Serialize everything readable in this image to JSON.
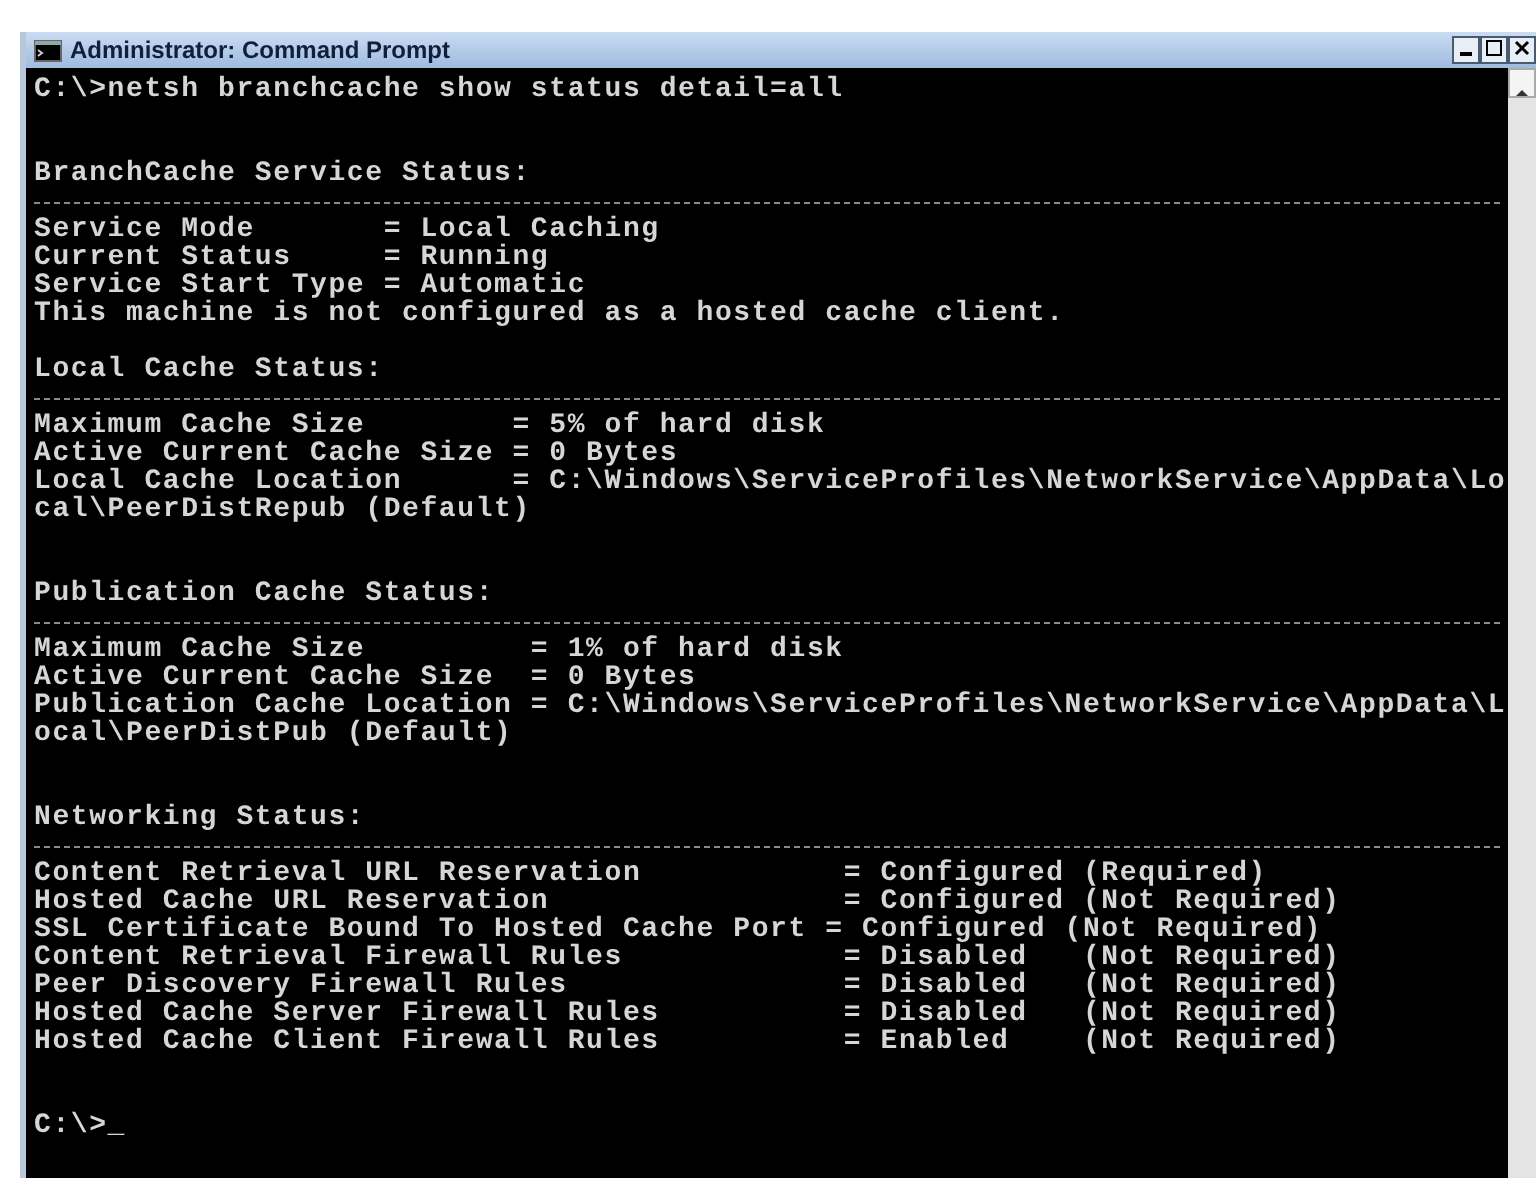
{
  "window": {
    "title": "Administrator: Command Prompt"
  },
  "console": [
    {
      "kind": "line",
      "text": "C:\\>netsh branchcache show status detail=all"
    },
    {
      "kind": "blank"
    },
    {
      "kind": "blank"
    },
    {
      "kind": "line",
      "text": "BranchCache Service Status:"
    },
    {
      "kind": "rule"
    },
    {
      "kind": "line",
      "text": "Service Mode       = Local Caching"
    },
    {
      "kind": "line",
      "text": "Current Status     = Running"
    },
    {
      "kind": "line",
      "text": "Service Start Type = Automatic"
    },
    {
      "kind": "line",
      "text": "This machine is not configured as a hosted cache client."
    },
    {
      "kind": "blank"
    },
    {
      "kind": "line",
      "text": "Local Cache Status:"
    },
    {
      "kind": "rule"
    },
    {
      "kind": "line",
      "text": "Maximum Cache Size        = 5% of hard disk"
    },
    {
      "kind": "line",
      "text": "Active Current Cache Size = 0 Bytes"
    },
    {
      "kind": "line",
      "text": "Local Cache Location      = C:\\Windows\\ServiceProfiles\\NetworkService\\AppData\\Lo"
    },
    {
      "kind": "line",
      "text": "cal\\PeerDistRepub (Default)"
    },
    {
      "kind": "blank"
    },
    {
      "kind": "blank"
    },
    {
      "kind": "line",
      "text": "Publication Cache Status:"
    },
    {
      "kind": "rule"
    },
    {
      "kind": "line",
      "text": "Maximum Cache Size         = 1% of hard disk"
    },
    {
      "kind": "line",
      "text": "Active Current Cache Size  = 0 Bytes"
    },
    {
      "kind": "line",
      "text": "Publication Cache Location = C:\\Windows\\ServiceProfiles\\NetworkService\\AppData\\L"
    },
    {
      "kind": "line",
      "text": "ocal\\PeerDistPub (Default)"
    },
    {
      "kind": "blank"
    },
    {
      "kind": "blank"
    },
    {
      "kind": "line",
      "text": "Networking Status:"
    },
    {
      "kind": "rule"
    },
    {
      "kind": "line",
      "text": "Content Retrieval URL Reservation           = Configured (Required)"
    },
    {
      "kind": "line",
      "text": "Hosted Cache URL Reservation                = Configured (Not Required)"
    },
    {
      "kind": "line",
      "text": "SSL Certificate Bound To Hosted Cache Port = Configured (Not Required)"
    },
    {
      "kind": "line",
      "text": "Content Retrieval Firewall Rules            = Disabled   (Not Required)"
    },
    {
      "kind": "line",
      "text": "Peer Discovery Firewall Rules               = Disabled   (Not Required)"
    },
    {
      "kind": "line",
      "text": "Hosted Cache Server Firewall Rules          = Disabled   (Not Required)"
    },
    {
      "kind": "line",
      "text": "Hosted Cache Client Firewall Rules          = Enabled    (Not Required)"
    },
    {
      "kind": "blank"
    },
    {
      "kind": "blank"
    },
    {
      "kind": "line",
      "text": "C:\\>_"
    }
  ]
}
